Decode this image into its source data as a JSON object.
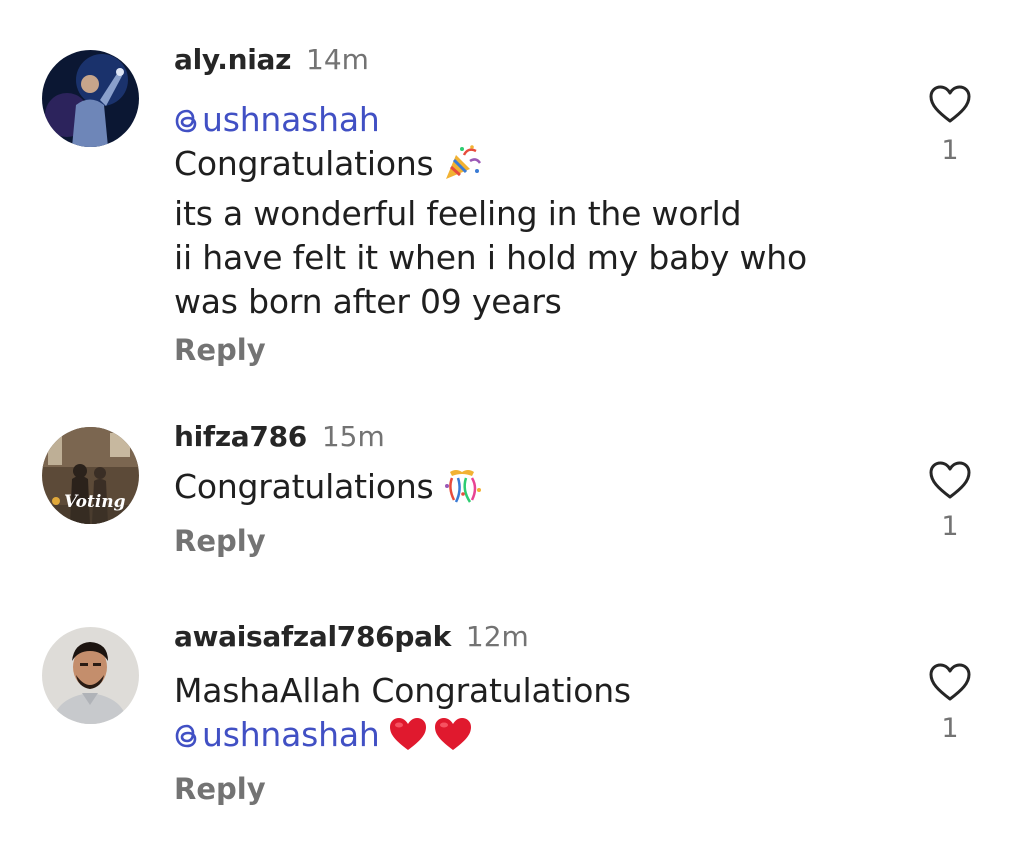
{
  "comments": [
    {
      "username": "aly.niaz",
      "time": "14m",
      "mention": "ushnashah",
      "lines": [
        "Congratulations",
        "its a wonderful feeling in the world",
        "ii have felt it when i hold my baby who",
        "was born after 09 years"
      ],
      "emoji": "party-popper",
      "reply_label": "Reply",
      "like_count": "1"
    },
    {
      "username": "hifza786",
      "time": "15m",
      "lines": [
        "Congratulations"
      ],
      "emoji": "confetti-ball",
      "avatar_text": "Voting",
      "reply_label": "Reply",
      "like_count": "1"
    },
    {
      "username": "awaisafzal786pak",
      "time": "12m",
      "lines": [
        "MashaAllah Congratulations"
      ],
      "mention": "ushnashah",
      "mention_suffix_emoji": "red-heart x2",
      "reply_label": "Reply",
      "like_count": "1"
    }
  ],
  "colors": {
    "mention": "#4150c4",
    "muted": "#737373",
    "text": "#1f1f1f",
    "heart_red": "#e0192e"
  }
}
